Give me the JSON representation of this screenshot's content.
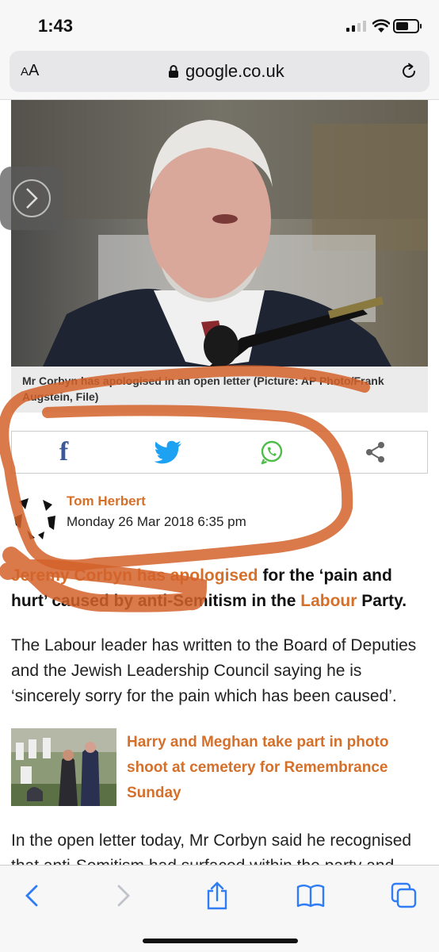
{
  "status_bar": {
    "time": "1:43"
  },
  "address_bar": {
    "aa_small": "A",
    "aa_big": "A",
    "url": "google.co.uk"
  },
  "article": {
    "caption": "Mr Corbyn has apologised in an open letter (Picture: AP Photo/Frank Augstein, File)",
    "share": {
      "facebook": "f"
    },
    "author": {
      "name": "Tom Herbert",
      "date": "Monday 26 Mar 2018 6:35 pm"
    },
    "lede": {
      "link1": "Jeremy Corbyn has apologised",
      "text1": " for the ‘pain and hurt’ caused by anti-Semitism in the ",
      "link2": "Labour",
      "text2": " Party."
    },
    "paragraph1": "The Labour leader has written to the Board of Deputies and the Jewish Leadership Council saying he is ‘sincerely sorry for the pain which has been caused’.",
    "related": {
      "title": "Harry and Meghan take part in photo shoot at cemetery for Remembrance Sunday"
    },
    "paragraph2_line1": "In the open letter today, Mr Corbyn said he recognised",
    "paragraph2_line2": "that anti-Semitism had surfaced within the party and"
  },
  "colors": {
    "accent_orange": "#d5702b",
    "facebook_blue": "#3b5998",
    "twitter_blue": "#1da1f2",
    "whatsapp_green": "#4fbd4a",
    "ios_blue": "#2f7cf6",
    "annotation_orange": "#d4622a"
  },
  "icons": [
    "signal-icon",
    "wifi-icon",
    "battery-icon",
    "lock-icon",
    "reload-icon",
    "chevron-right-icon",
    "facebook-icon",
    "twitter-icon",
    "whatsapp-icon",
    "share-icon",
    "back-icon",
    "forward-icon",
    "share-sheet-icon",
    "bookmarks-icon",
    "tabs-icon"
  ]
}
